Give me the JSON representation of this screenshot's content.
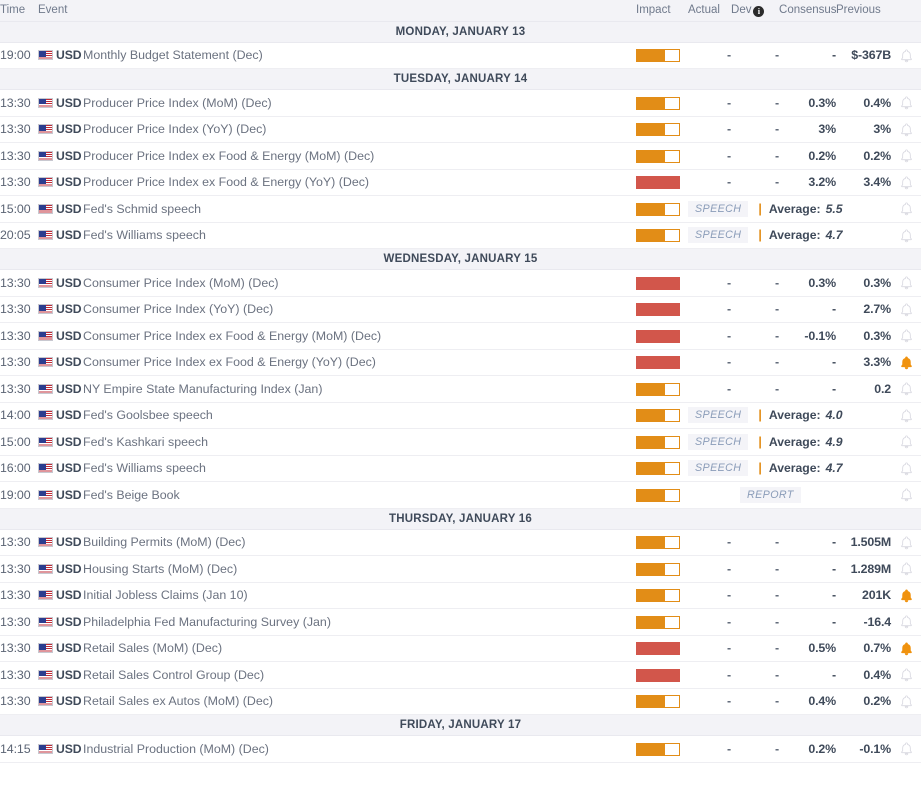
{
  "header": {
    "time": "Time",
    "event": "Event",
    "impact": "Impact",
    "actual": "Actual",
    "dev": "Dev",
    "dev_info_icon": "info-icon",
    "consensus": "Consensus",
    "previous": "Previous"
  },
  "colors": {
    "impact_medium": "#e28d17",
    "impact_high": "#d2564b",
    "alert_active": "#f0920e",
    "alert_inactive": "#d8d8e0",
    "day_header_bg": "#f3f3f7",
    "text_primary": "#3f4a5a",
    "text_secondary": "#6b7280"
  },
  "labels": {
    "average": "Average:",
    "separator": "|",
    "speech_badge": "SPEECH",
    "report_badge": "REPORT",
    "dash": "-",
    "currency": "USD",
    "flag": "us-flag-icon"
  },
  "days": [
    {
      "label": "MONDAY, JANUARY 13",
      "rows": [
        {
          "time": "19:00",
          "currency": "USD",
          "event": "Monthly Budget Statement (Dec)",
          "impact": "medium",
          "type": "data",
          "actual": "-",
          "dev": "-",
          "consensus": "-",
          "previous": "$-367B",
          "alert": false
        }
      ]
    },
    {
      "label": "TUESDAY, JANUARY 14",
      "rows": [
        {
          "time": "13:30",
          "currency": "USD",
          "event": "Producer Price Index (MoM) (Dec)",
          "impact": "medium",
          "type": "data",
          "actual": "-",
          "dev": "-",
          "consensus": "0.3%",
          "previous": "0.4%",
          "alert": false
        },
        {
          "time": "13:30",
          "currency": "USD",
          "event": "Producer Price Index (YoY) (Dec)",
          "impact": "medium",
          "type": "data",
          "actual": "-",
          "dev": "-",
          "consensus": "3%",
          "previous": "3%",
          "alert": false
        },
        {
          "time": "13:30",
          "currency": "USD",
          "event": "Producer Price Index ex Food & Energy (MoM) (Dec)",
          "impact": "medium",
          "type": "data",
          "actual": "-",
          "dev": "-",
          "consensus": "0.2%",
          "previous": "0.2%",
          "alert": false
        },
        {
          "time": "13:30",
          "currency": "USD",
          "event": "Producer Price Index ex Food & Energy (YoY) (Dec)",
          "impact": "high",
          "type": "data",
          "actual": "-",
          "dev": "-",
          "consensus": "3.2%",
          "previous": "3.4%",
          "alert": false
        },
        {
          "time": "15:00",
          "currency": "USD",
          "event": "Fed's Schmid speech",
          "impact": "medium",
          "type": "speech",
          "badge": "SPEECH",
          "average": "5.5",
          "alert": false
        },
        {
          "time": "20:05",
          "currency": "USD",
          "event": "Fed's Williams speech",
          "impact": "medium",
          "type": "speech",
          "badge": "SPEECH",
          "average": "4.7",
          "alert": false
        }
      ]
    },
    {
      "label": "WEDNESDAY, JANUARY 15",
      "rows": [
        {
          "time": "13:30",
          "currency": "USD",
          "event": "Consumer Price Index (MoM) (Dec)",
          "impact": "high",
          "type": "data",
          "actual": "-",
          "dev": "-",
          "consensus": "0.3%",
          "previous": "0.3%",
          "alert": false
        },
        {
          "time": "13:30",
          "currency": "USD",
          "event": "Consumer Price Index (YoY) (Dec)",
          "impact": "high",
          "type": "data",
          "actual": "-",
          "dev": "-",
          "consensus": "-",
          "previous": "2.7%",
          "alert": false
        },
        {
          "time": "13:30",
          "currency": "USD",
          "event": "Consumer Price Index ex Food & Energy (MoM) (Dec)",
          "impact": "high",
          "type": "data",
          "actual": "-",
          "dev": "-",
          "consensus": "-0.1%",
          "previous": "0.3%",
          "alert": false
        },
        {
          "time": "13:30",
          "currency": "USD",
          "event": "Consumer Price Index ex Food & Energy (YoY) (Dec)",
          "impact": "high",
          "type": "data",
          "actual": "-",
          "dev": "-",
          "consensus": "-",
          "previous": "3.3%",
          "alert": true
        },
        {
          "time": "13:30",
          "currency": "USD",
          "event": "NY Empire State Manufacturing Index (Jan)",
          "impact": "medium",
          "type": "data",
          "actual": "-",
          "dev": "-",
          "consensus": "-",
          "previous": "0.2",
          "alert": false
        },
        {
          "time": "14:00",
          "currency": "USD",
          "event": "Fed's Goolsbee speech",
          "impact": "medium",
          "type": "speech",
          "badge": "SPEECH",
          "average": "4.0",
          "alert": false
        },
        {
          "time": "15:00",
          "currency": "USD",
          "event": "Fed's Kashkari speech",
          "impact": "medium",
          "type": "speech",
          "badge": "SPEECH",
          "average": "4.9",
          "alert": false
        },
        {
          "time": "16:00",
          "currency": "USD",
          "event": "Fed's Williams speech",
          "impact": "medium",
          "type": "speech",
          "badge": "SPEECH",
          "average": "4.7",
          "alert": false
        },
        {
          "time": "19:00",
          "currency": "USD",
          "event": "Fed's Beige Book",
          "impact": "medium",
          "type": "report",
          "badge": "REPORT",
          "alert": false
        }
      ]
    },
    {
      "label": "THURSDAY, JANUARY 16",
      "rows": [
        {
          "time": "13:30",
          "currency": "USD",
          "event": "Building Permits (MoM) (Dec)",
          "impact": "medium",
          "type": "data",
          "actual": "-",
          "dev": "-",
          "consensus": "-",
          "previous": "1.505M",
          "alert": false
        },
        {
          "time": "13:30",
          "currency": "USD",
          "event": "Housing Starts (MoM) (Dec)",
          "impact": "medium",
          "type": "data",
          "actual": "-",
          "dev": "-",
          "consensus": "-",
          "previous": "1.289M",
          "alert": false
        },
        {
          "time": "13:30",
          "currency": "USD",
          "event": "Initial Jobless Claims (Jan 10)",
          "impact": "medium",
          "type": "data",
          "actual": "-",
          "dev": "-",
          "consensus": "-",
          "previous": "201K",
          "alert": true
        },
        {
          "time": "13:30",
          "currency": "USD",
          "event": "Philadelphia Fed Manufacturing Survey (Jan)",
          "impact": "medium",
          "type": "data",
          "actual": "-",
          "dev": "-",
          "consensus": "-",
          "previous": "-16.4",
          "alert": false
        },
        {
          "time": "13:30",
          "currency": "USD",
          "event": "Retail Sales (MoM) (Dec)",
          "impact": "high",
          "type": "data",
          "actual": "-",
          "dev": "-",
          "consensus": "0.5%",
          "previous": "0.7%",
          "alert": true
        },
        {
          "time": "13:30",
          "currency": "USD",
          "event": "Retail Sales Control Group (Dec)",
          "impact": "high",
          "type": "data",
          "actual": "-",
          "dev": "-",
          "consensus": "-",
          "previous": "0.4%",
          "alert": false
        },
        {
          "time": "13:30",
          "currency": "USD",
          "event": "Retail Sales ex Autos (MoM) (Dec)",
          "impact": "medium",
          "type": "data",
          "actual": "-",
          "dev": "-",
          "consensus": "0.4%",
          "previous": "0.2%",
          "alert": false
        }
      ]
    },
    {
      "label": "FRIDAY, JANUARY 17",
      "rows": [
        {
          "time": "14:15",
          "currency": "USD",
          "event": "Industrial Production (MoM) (Dec)",
          "impact": "medium",
          "type": "data",
          "actual": "-",
          "dev": "-",
          "consensus": "0.2%",
          "previous": "-0.1%",
          "alert": false
        }
      ]
    }
  ]
}
